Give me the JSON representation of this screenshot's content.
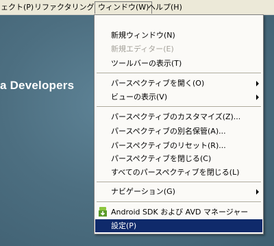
{
  "menubar": {
    "items": [
      {
        "label": "ェクト(P)"
      },
      {
        "label": "リファクタリング(T)"
      },
      {
        "label": "ウィンドウ(W)"
      },
      {
        "label": "ヘルプ(H)"
      }
    ]
  },
  "background": {
    "title": "a Developers"
  },
  "window_menu": {
    "items": [
      {
        "label": "新規ウィンドウ(N)"
      },
      {
        "label": "新規エディター(E)"
      },
      {
        "label": "ツールバーの表示(T)"
      },
      {
        "label": "パースペクティブを開く(O)"
      },
      {
        "label": "ビューの表示(V)"
      },
      {
        "label": "パースペクティブのカスタマイズ(Z)..."
      },
      {
        "label": "パースペクティブの別名保管(A)..."
      },
      {
        "label": "パースペクティブのリセット(R)..."
      },
      {
        "label": "パースペクティブを閉じる(C)"
      },
      {
        "label": "すべてのパースペクティブを閉じる(L)"
      },
      {
        "label": "ナビゲーション(G)"
      },
      {
        "label": "Android SDK および AVD マネージャー",
        "icon": "android-sdk-manager-icon"
      },
      {
        "label": "設定(P)"
      }
    ]
  },
  "colors": {
    "selection": "#0f2a6b",
    "menubar": "#ece9d8",
    "workspace": "#4a6b7d",
    "android_green": "#8dc63f"
  }
}
